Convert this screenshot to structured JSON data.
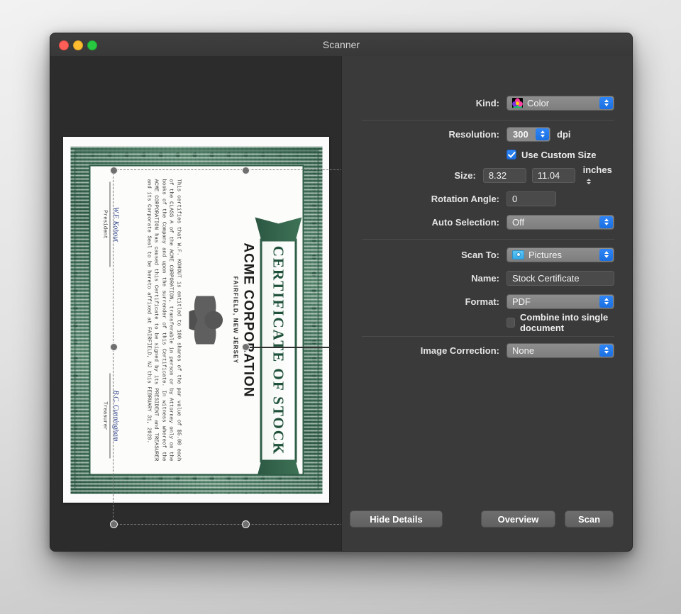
{
  "window": {
    "title": "Scanner",
    "traffic_lights": [
      "close",
      "minimize",
      "zoom"
    ]
  },
  "preview": {
    "certificate": {
      "banner_text": "CERTIFICATE OF STOCK",
      "company": "ACME CORPORATION",
      "city": "FAIRFIELD, NEW JERSEY",
      "body": "This certifies that W.F. KOHOUT is entitled to 100 shares of the par value of $5.00 each of the CLASS A of the ACME CORPORATION, transferable in person or by Attorney only on the books of the Company and upon the surrender of this Certificate. In witness whereof the ACME CORPORATION has caused this Certificate to be signed by its PRESIDENT and TREASURER and its Corporate Seal to be hereto affixed at FAIRFIELD, NJ this FEBRUARY 31, 2020.",
      "signature_left_name": "W.F. Kohout",
      "signature_left_role": "President",
      "signature_right_name": "B.C. Cunningham",
      "signature_right_role": "Treasurer"
    }
  },
  "settings": {
    "kind": {
      "label": "Kind:",
      "value": "Color",
      "icon": "color-swatch-icon"
    },
    "resolution": {
      "label": "Resolution:",
      "value": "300",
      "unit": "dpi"
    },
    "use_custom_size": {
      "label": "Use Custom Size",
      "checked": true
    },
    "size": {
      "label": "Size:",
      "width": "8.32",
      "height": "11.04",
      "unit": "inches"
    },
    "rotation_angle": {
      "label": "Rotation Angle:",
      "value": "0"
    },
    "auto_selection": {
      "label": "Auto Selection:",
      "value": "Off"
    },
    "scan_to": {
      "label": "Scan To:",
      "value": "Pictures",
      "icon": "pictures-folder-icon"
    },
    "name": {
      "label": "Name:",
      "value": "Stock Certificate"
    },
    "format": {
      "label": "Format:",
      "value": "PDF"
    },
    "combine": {
      "label": "Combine into single document",
      "checked": false
    },
    "image_correction": {
      "label": "Image Correction:",
      "value": "None"
    }
  },
  "buttons": {
    "hide_details": "Hide Details",
    "overview": "Overview",
    "scan": "Scan"
  },
  "colors": {
    "window_bg": "#3a3a3a",
    "preview_bg": "#2c2c2c",
    "accent_blue": "#2f86f7",
    "certificate_green": "#2f5e47"
  }
}
